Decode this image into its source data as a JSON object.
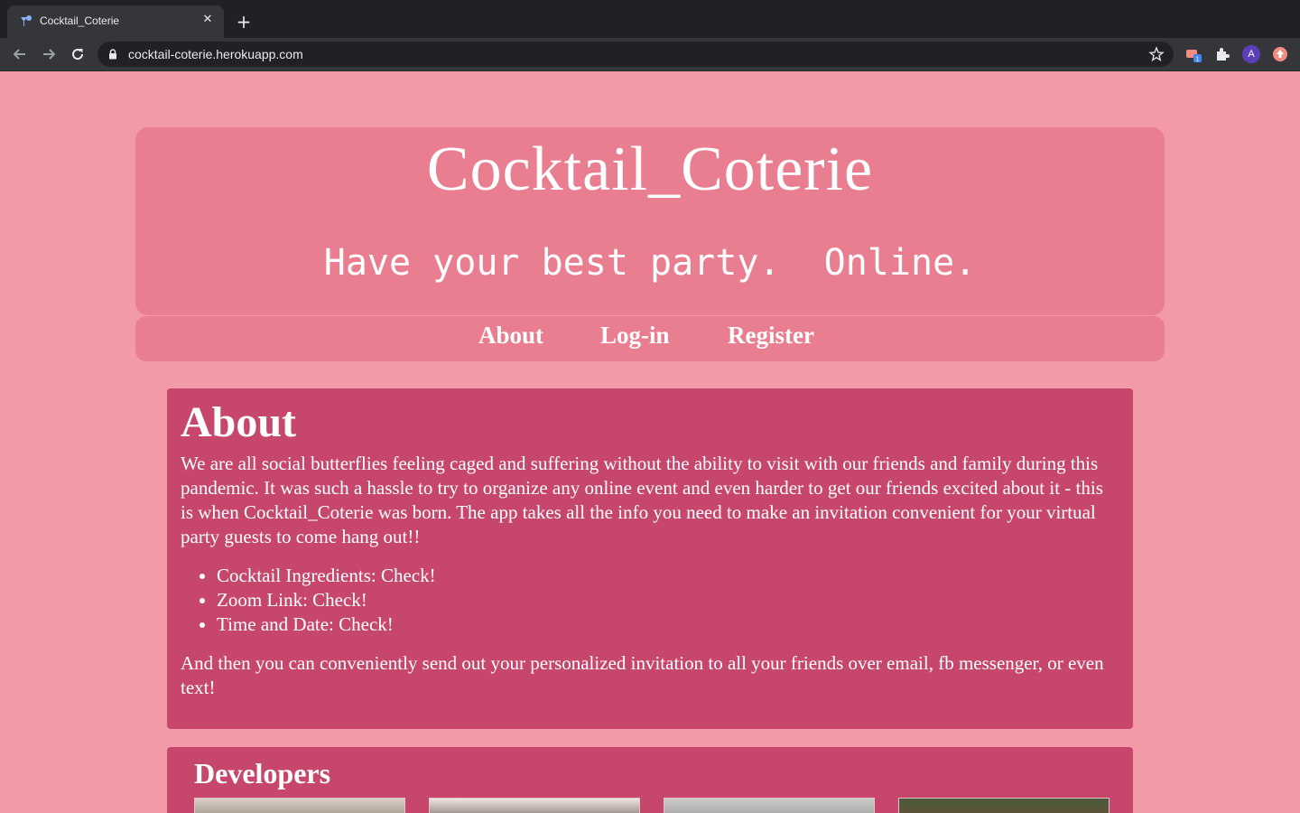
{
  "browser": {
    "tab_title": "Cocktail_Coterie",
    "tab_close": "✕",
    "new_tab": "+",
    "url": "cocktail-coterie.herokuapp.com",
    "profile_initial": "A"
  },
  "header": {
    "title": "Cocktail_Coterie",
    "tagline": "Have your best party.  Online."
  },
  "nav": {
    "about": "About",
    "login": "Log-in",
    "register": "Register"
  },
  "about": {
    "heading": "About",
    "intro": "We are all social butterflies feeling caged and suffering without the ability to visit with our friends and family during this pandemic. It was such a hassle to try to organize any online event and even harder to get our friends excited about it - this is when Cocktail_Coterie was born. The app takes all the info you need to make an invitation convenient for your virtual party guests to come hang out!!",
    "items": [
      "Cocktail Ingredients: Check!",
      "Zoom Link: Check!",
      "Time and Date: Check!"
    ],
    "outro": "And then you can conveniently send out your personalized invitation to all your friends over email, fb messenger, or even text!"
  },
  "developers": {
    "heading": "Developers"
  },
  "colors": {
    "page_bg": "#f29aa8",
    "header_bg": "#e97e90",
    "section_bg": "#c6466c",
    "text": "#ffffff"
  }
}
